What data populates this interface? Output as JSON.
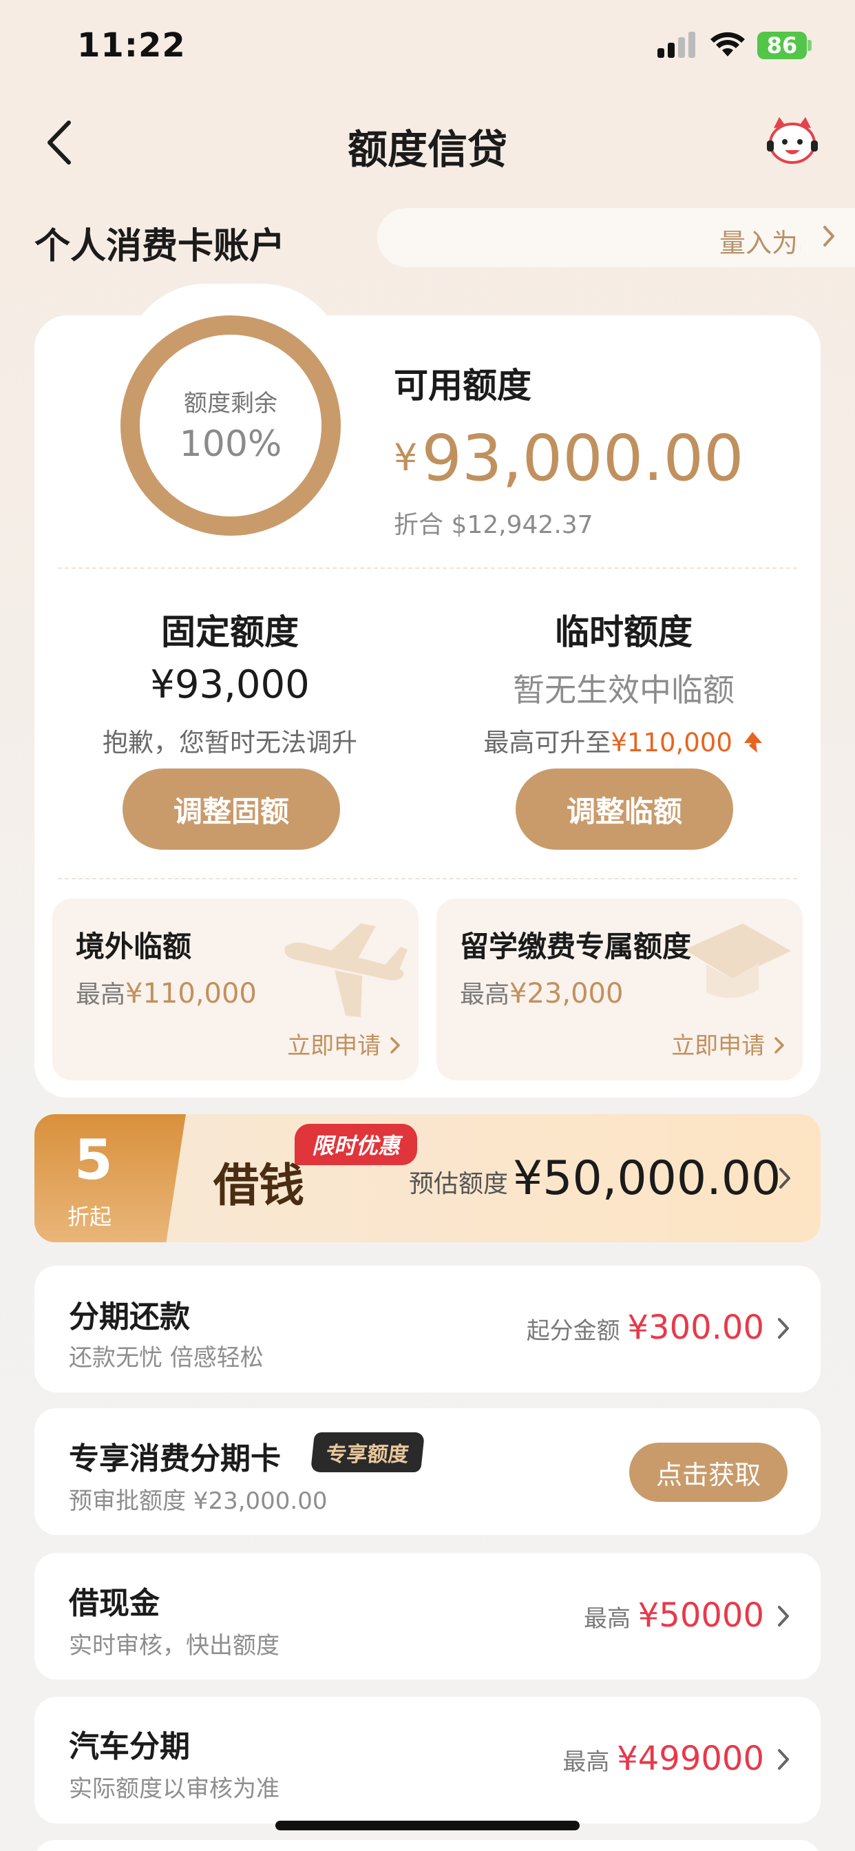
{
  "status_bar": {
    "time": "11:22",
    "battery": "86"
  },
  "nav": {
    "title": "额度信贷",
    "back_icon": "chevron-left-icon",
    "mascot_icon": "mascot-avatar-icon"
  },
  "account": {
    "title": "个人消费卡账户",
    "pill_text": "量入为出"
  },
  "quota": {
    "ring_label": "额度剩余",
    "ring_value": "100%",
    "remaining_fraction": 1.0,
    "available_label": "可用额度",
    "currency": "¥",
    "available_amount": "93,000.00",
    "equivalent": "折合 $12,942.37"
  },
  "fixed": {
    "title": "固定额度",
    "amount": "¥93,000",
    "note": "抱歉，您暂时无法调升",
    "button": "调整固额"
  },
  "temporary": {
    "title": "临时额度",
    "status": "暂无生效中临额",
    "max_prefix": "最高可升至",
    "max_amount": "¥110,000",
    "button": "调整临额"
  },
  "promos": [
    {
      "title": "境外临额",
      "max_prefix": "最高",
      "max_amount": "¥110,000",
      "link": "立即申请",
      "icon": "airplane-icon"
    },
    {
      "title": "留学缴费专属额度",
      "max_prefix": "最高",
      "max_amount": "¥23,000",
      "link": "立即申请",
      "icon": "graduation-cap-icon"
    }
  ],
  "loan_banner": {
    "discount": "5",
    "discount_unit": "折起",
    "title": "借钱",
    "tag": "限时优惠",
    "est_label": "预估额度",
    "est_amount": "¥50,000.00"
  },
  "rows": [
    {
      "title": "分期还款",
      "sub": "还款无忧 倍感轻松",
      "right_label": "起分金额",
      "right_value": "¥300.00"
    },
    {
      "title": "专享消费分期卡",
      "tag": "专享额度",
      "sub": "预审批额度 ¥23,000.00",
      "button": "点击获取"
    },
    {
      "title": "借现金",
      "sub": "实时审核，快出额度",
      "right_label": "最高",
      "right_value": "¥50000"
    },
    {
      "title": "汽车分期",
      "sub": "实际额度以审核为准",
      "right_label": "最高",
      "right_value": "¥499000"
    }
  ],
  "colors": {
    "accent": "#c99b6b",
    "price_red": "#e8394a",
    "orange": "#e8641e",
    "battery_green": "#53c548"
  }
}
